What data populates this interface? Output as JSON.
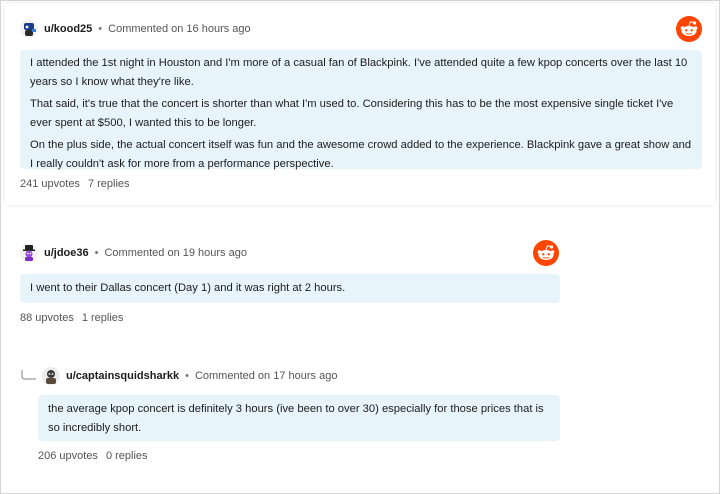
{
  "comments": [
    {
      "username": "u/kood25",
      "separator": "•",
      "meta": "Commented on 16 hours ago",
      "paragraphs": [
        "I attended the 1st night in Houston and I'm more of a casual fan of Blackpink. I've attended quite a few kpop concerts over the last 10 years so I know what they're like.",
        "That said, it's true that the concert is shorter than what I'm used to. Considering this has to be the most expensive single ticket I've ever spent at $500, I wanted this to be longer.",
        "On the plus side, the actual concert itself was fun and the awesome crowd added to the experience. Blackpink gave a great show and I really couldn't ask for more from a performance perspective."
      ],
      "upvotes": "241 upvotes",
      "replies": "7 replies"
    },
    {
      "username": "u/jdoe36",
      "separator": "•",
      "meta": "Commented on 19 hours ago",
      "paragraphs": [
        "I went to their Dallas concert (Day 1) and it was right at 2 hours."
      ],
      "upvotes": "88 upvotes",
      "replies": "1 replies"
    },
    {
      "username": "u/captainsquidsharkk",
      "separator": "•",
      "meta": "Commented on 17 hours ago",
      "paragraphs": [
        "the average kpop concert is definitely 3 hours (ive been to over 30) especially for those prices that is so incredibly short."
      ],
      "upvotes": "206 upvotes",
      "replies": "0 replies"
    }
  ],
  "colors": {
    "bubble": "#e8f4fb",
    "reddit_orange": "#ff4500"
  }
}
